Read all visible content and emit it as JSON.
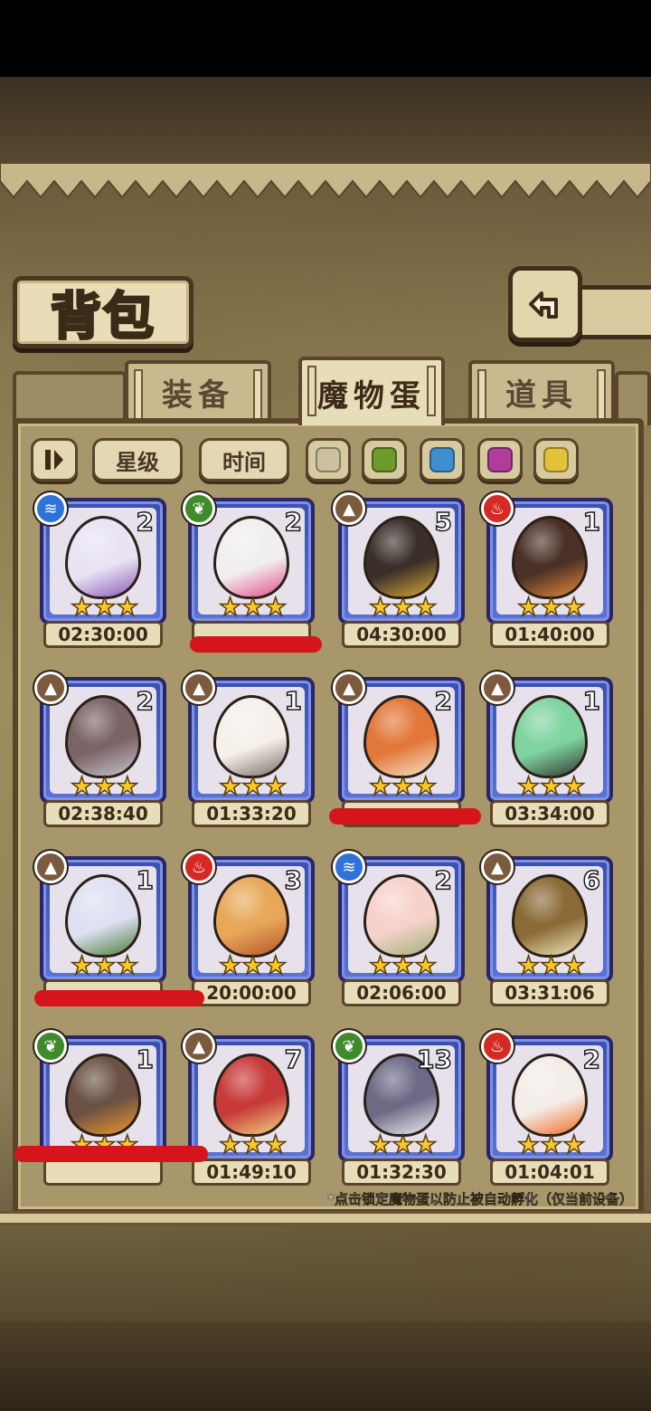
{
  "header": {
    "title": "背包"
  },
  "tabs": [
    {
      "label": "装备",
      "active": false
    },
    {
      "label": "魔物蛋",
      "active": true
    },
    {
      "label": "道具",
      "active": false
    }
  ],
  "filters": {
    "sort_icon": "sort-toggle-icon",
    "star_label": "星级",
    "time_label": "时间",
    "colors": [
      "#cbc1a0",
      "#6e9a2c",
      "#3f8fd0",
      "#b03c9c",
      "#e3c23b"
    ]
  },
  "eggs": [
    {
      "element": "water",
      "count": "2",
      "timer": "02:30:00",
      "color": "#e9e3f4",
      "accent": "#8c5bb8"
    },
    {
      "element": "grass",
      "count": "2",
      "timer": "",
      "color": "#f1eef0",
      "accent": "#e04f86"
    },
    {
      "element": "earth",
      "count": "5",
      "timer": "04:30:00",
      "color": "#3b2f2a",
      "accent": "#d9a93a"
    },
    {
      "element": "fire",
      "count": "1",
      "timer": "01:40:00",
      "color": "#4a3026",
      "accent": "#e58a3a"
    },
    {
      "element": "earth",
      "count": "2",
      "timer": "02:38:40",
      "color": "#7a6466",
      "accent": "#c9c2cf"
    },
    {
      "element": "earth",
      "count": "1",
      "timer": "01:33:20",
      "color": "#f5f0ea",
      "accent": "#7d6f69"
    },
    {
      "element": "earth",
      "count": "2",
      "timer": "",
      "color": "#e2773a",
      "accent": "#f4e2c4"
    },
    {
      "element": "earth",
      "count": "1",
      "timer": "03:34:00",
      "color": "#7fd4a0",
      "accent": "#2e3b33"
    },
    {
      "element": "earth",
      "count": "1",
      "timer": "",
      "color": "#dfe0f2",
      "accent": "#4a7d3b"
    },
    {
      "element": "fire",
      "count": "3",
      "timer": "20:00:00",
      "color": "#e8a85a",
      "accent": "#b4562a"
    },
    {
      "element": "water",
      "count": "2",
      "timer": "02:06:00",
      "color": "#f7d2cb",
      "accent": "#a0b07a"
    },
    {
      "element": "earth",
      "count": "6",
      "timer": "03:31:06",
      "color": "#8a6a36",
      "accent": "#f1e6b9"
    },
    {
      "element": "grass",
      "count": "1",
      "timer": "",
      "color": "#6b5244",
      "accent": "#f0962b"
    },
    {
      "element": "earth",
      "count": "7",
      "timer": "01:49:10",
      "color": "#c73a3a",
      "accent": "#f3d37e"
    },
    {
      "element": "grass",
      "count": "13",
      "timer": "01:32:30",
      "color": "#6d6a86",
      "accent": "#f0eef4"
    },
    {
      "element": "fire",
      "count": "2",
      "timer": "01:04:01",
      "color": "#f3ede8",
      "accent": "#f06a24"
    }
  ],
  "footer_note": "*点击锁定魔物蛋以防止被自动孵化（仅当前设备）",
  "element_colors": {
    "water": "#2f72d8",
    "grass": "#3f8a2a",
    "earth": "#7b5a3e",
    "fire": "#d52a24"
  }
}
